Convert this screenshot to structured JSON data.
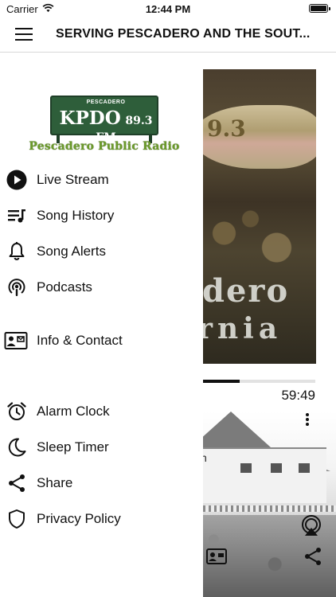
{
  "status_bar": {
    "carrier": "Carrier",
    "time": "12:44 PM"
  },
  "header": {
    "title": "SERVING PESCADERO AND THE SOUT..."
  },
  "drawer": {
    "logo": {
      "board_top": "PESCADERO",
      "callsign": "KPDO",
      "frequency": "89.3",
      "band": "FM",
      "tagline": "Pescadero Public Radio"
    },
    "items": [
      {
        "label": "Live Stream",
        "icon": "play-circle-icon"
      },
      {
        "label": "Song History",
        "icon": "playlist-icon"
      },
      {
        "label": "Song Alerts",
        "icon": "bell-icon"
      },
      {
        "label": "Podcasts",
        "icon": "podcast-icon"
      },
      {
        "label": "Info & Contact",
        "icon": "contact-card-icon"
      },
      {
        "label": "Alarm Clock",
        "icon": "alarm-clock-icon"
      },
      {
        "label": "Sleep Timer",
        "icon": "moon-icon"
      },
      {
        "label": "Share",
        "icon": "share-icon"
      },
      {
        "label": "Privacy Policy",
        "icon": "shield-icon"
      }
    ]
  },
  "player": {
    "artwork_frequency": "9.3",
    "artwork_line1": "dero",
    "artwork_line2": "rnia",
    "elapsed_time": "59:49",
    "progress_fraction": 0.43,
    "photo_text": "n"
  }
}
